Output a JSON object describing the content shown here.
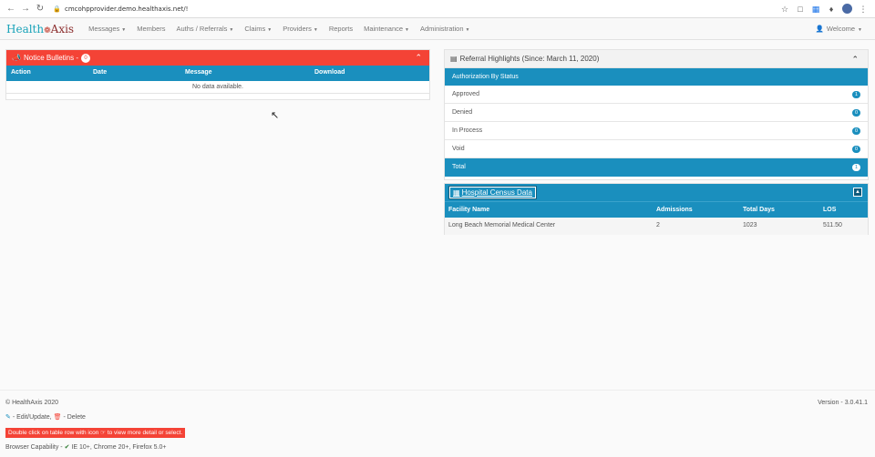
{
  "browser": {
    "url": "cmcohpprovider.demo.healthaxis.net/!"
  },
  "navbar": {
    "logo_health": "Health",
    "logo_axis": "Axis",
    "items": [
      "Messages",
      "Members",
      "Auths / Referrals",
      "Claims",
      "Providers",
      "Reports",
      "Maintenance",
      "Administration"
    ],
    "welcome": "Welcome"
  },
  "notice": {
    "title": "Notice Bulletins -",
    "count": "0",
    "columns": [
      "Action",
      "Date",
      "Message",
      "Download"
    ],
    "empty_text": "No data available."
  },
  "referral": {
    "title": "Referral Highlights (Since: March 11, 2020)",
    "subheader": "Authorization By Status",
    "rows": [
      {
        "label": "Approved",
        "count": "1"
      },
      {
        "label": "Denied",
        "count": "0"
      },
      {
        "label": "In Process",
        "count": "0"
      },
      {
        "label": "Void",
        "count": "0"
      }
    ],
    "total_label": "Total",
    "total_count": "1"
  },
  "census": {
    "title": "Hospital Census Data",
    "columns": [
      "Facility Name",
      "Admissions",
      "Total Days",
      "LOS"
    ],
    "row": {
      "facility": "Long Beach Memorial Medical Center",
      "admissions": "2",
      "total_days": "1023",
      "los": "511.50"
    }
  },
  "footer": {
    "copyright": "© HealthAxis 2020",
    "version": "Version - 3.0.41.1",
    "legend_edit": "- Edit/Update,",
    "legend_delete": "- Delete",
    "hint_before": "Double click on table row with icon",
    "hint_after": "to view more detail or select.",
    "browser_label": "Browser Capability -",
    "browser_text": "IE 10+, Chrome 20+, Firefox 5.0+"
  }
}
